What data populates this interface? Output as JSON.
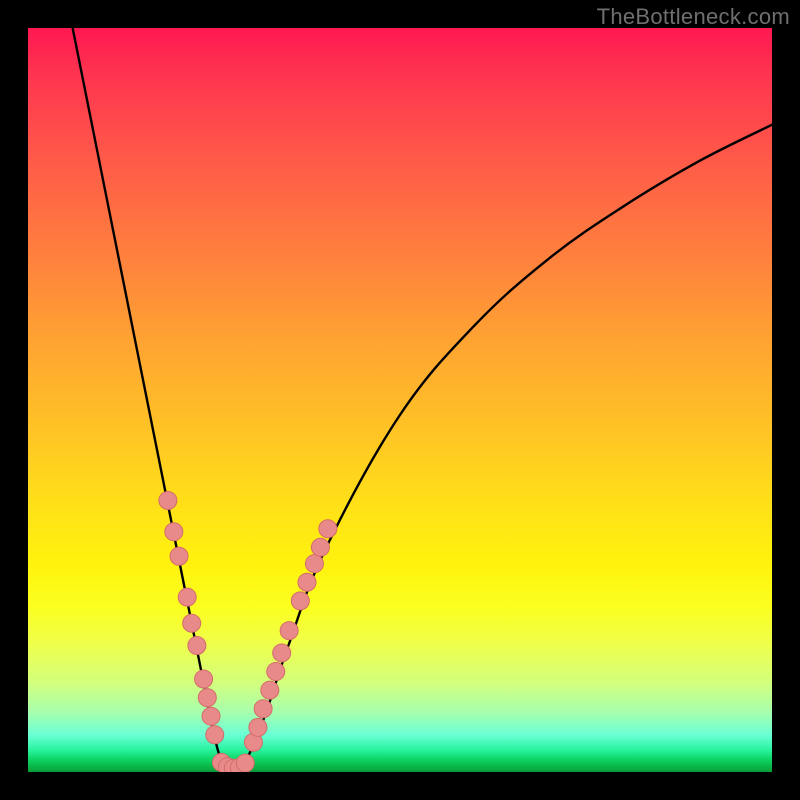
{
  "watermark": "TheBottleneck.com",
  "colors": {
    "curve": "#000000",
    "marker_fill": "#e98a8a",
    "marker_stroke": "#d46b6b"
  },
  "chart_data": {
    "type": "line",
    "title": "",
    "xlabel": "",
    "ylabel": "",
    "xlim": [
      0,
      100
    ],
    "ylim": [
      0,
      100
    ],
    "grid": false,
    "legend": false,
    "x_vertex": 27,
    "curve": [
      {
        "x": 6,
        "y": 100
      },
      {
        "x": 10,
        "y": 80
      },
      {
        "x": 14,
        "y": 60
      },
      {
        "x": 18,
        "y": 40
      },
      {
        "x": 20,
        "y": 30
      },
      {
        "x": 22,
        "y": 20
      },
      {
        "x": 24,
        "y": 10
      },
      {
        "x": 25,
        "y": 5
      },
      {
        "x": 26,
        "y": 1.5
      },
      {
        "x": 27,
        "y": 0.5
      },
      {
        "x": 28,
        "y": 0.5
      },
      {
        "x": 29,
        "y": 1.2
      },
      {
        "x": 30,
        "y": 3
      },
      {
        "x": 32,
        "y": 8
      },
      {
        "x": 35,
        "y": 17
      },
      {
        "x": 40,
        "y": 30
      },
      {
        "x": 50,
        "y": 48
      },
      {
        "x": 60,
        "y": 60
      },
      {
        "x": 70,
        "y": 69
      },
      {
        "x": 80,
        "y": 76
      },
      {
        "x": 90,
        "y": 82
      },
      {
        "x": 100,
        "y": 87
      }
    ],
    "markers_left": [
      {
        "x": 18.8,
        "y": 36.5
      },
      {
        "x": 19.6,
        "y": 32.3
      },
      {
        "x": 20.3,
        "y": 29.0
      },
      {
        "x": 21.4,
        "y": 23.5
      },
      {
        "x": 22.0,
        "y": 20.0
      },
      {
        "x": 22.7,
        "y": 17.0
      },
      {
        "x": 23.6,
        "y": 12.5
      },
      {
        "x": 24.1,
        "y": 10.0
      },
      {
        "x": 24.6,
        "y": 7.5
      },
      {
        "x": 25.1,
        "y": 5.0
      }
    ],
    "markers_bottom": [
      {
        "x": 26.0,
        "y": 1.3
      },
      {
        "x": 26.8,
        "y": 0.7
      },
      {
        "x": 27.6,
        "y": 0.5
      },
      {
        "x": 28.4,
        "y": 0.6
      },
      {
        "x": 29.2,
        "y": 1.2
      }
    ],
    "markers_right": [
      {
        "x": 30.3,
        "y": 4.0
      },
      {
        "x": 30.9,
        "y": 6.0
      },
      {
        "x": 31.6,
        "y": 8.5
      },
      {
        "x": 32.5,
        "y": 11.0
      },
      {
        "x": 33.3,
        "y": 13.5
      },
      {
        "x": 34.1,
        "y": 16.0
      },
      {
        "x": 35.1,
        "y": 19.0
      },
      {
        "x": 36.6,
        "y": 23.0
      },
      {
        "x": 37.5,
        "y": 25.5
      },
      {
        "x": 38.5,
        "y": 28.0
      },
      {
        "x": 39.3,
        "y": 30.2
      },
      {
        "x": 40.3,
        "y": 32.7
      }
    ]
  }
}
